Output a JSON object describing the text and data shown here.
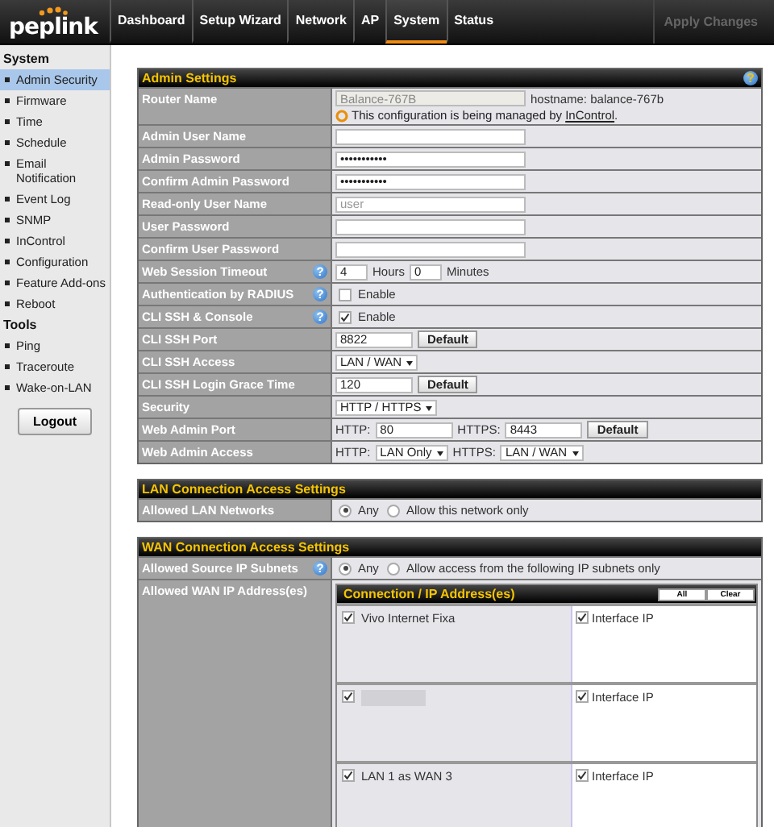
{
  "header": {
    "logo": "peplink",
    "tabs": [
      {
        "label": "Dashboard",
        "selected": false
      },
      {
        "label": "Setup Wizard",
        "selected": false
      },
      {
        "label": "Network",
        "selected": false
      },
      {
        "label": "AP",
        "selected": false
      },
      {
        "label": "System",
        "selected": true
      },
      {
        "label": "Status",
        "selected": false
      }
    ],
    "apply_button": {
      "label": "Apply Changes",
      "disabled": true
    }
  },
  "sidebar": {
    "sections": [
      {
        "title": "System",
        "items": [
          {
            "label": "Admin Security",
            "selected": true
          },
          {
            "label": "Firmware",
            "selected": false
          },
          {
            "label": "Time",
            "selected": false
          },
          {
            "label": "Schedule",
            "selected": false
          },
          {
            "label": "Email Notification",
            "selected": false
          },
          {
            "label": "Event Log",
            "selected": false
          },
          {
            "label": "SNMP",
            "selected": false
          },
          {
            "label": "InControl",
            "selected": false
          },
          {
            "label": "Configuration",
            "selected": false
          },
          {
            "label": "Feature Add-ons",
            "selected": false
          },
          {
            "label": "Reboot",
            "selected": false
          }
        ]
      },
      {
        "title": "Tools",
        "items": [
          {
            "label": "Ping",
            "selected": false
          },
          {
            "label": "Traceroute",
            "selected": false
          },
          {
            "label": "Wake-on-LAN",
            "selected": false
          }
        ]
      }
    ],
    "logout_button": "Logout"
  },
  "sections": [
    {
      "title": "Admin Settings",
      "help": "?",
      "rows": [
        {
          "label": "Router Name",
          "controls": [
            {
              "kind": "field",
              "value": "Balance-767B",
              "disabled": true
            },
            {
              "kind": "text",
              "text": "hostname: balance-767b"
            },
            {
              "kind": "notice",
              "text": "This configuration is being managed by ",
              "link": "InControl",
              "after": "."
            }
          ]
        },
        {
          "label": "Admin User Name",
          "controls": [
            {
              "kind": "field"
            }
          ]
        },
        {
          "label": "Admin Password",
          "controls": [
            {
              "kind": "field",
              "value": "•••••••••••"
            }
          ]
        },
        {
          "label": "Confirm Admin Password",
          "controls": [
            {
              "kind": "field",
              "value": "•••••••••••"
            }
          ]
        },
        {
          "label": "Read-only User Name",
          "controls": [
            {
              "kind": "field",
              "placeholder": "user"
            }
          ]
        },
        {
          "label": "User Password",
          "controls": [
            {
              "kind": "field"
            }
          ]
        },
        {
          "label": "Confirm User Password",
          "controls": [
            {
              "kind": "field"
            }
          ]
        },
        {
          "label": "Web Session Timeout",
          "help": "?",
          "controls": [
            {
              "kind": "number_field",
              "value": "4"
            },
            {
              "kind": "text",
              "text": "Hours"
            },
            {
              "kind": "number_field",
              "value": "0"
            },
            {
              "kind": "text",
              "text": "Minutes"
            }
          ]
        },
        {
          "label": "Authentication by RADIUS",
          "help": "?",
          "controls": [
            {
              "kind": "checkbox",
              "checked": false,
              "text": "Enable"
            }
          ]
        },
        {
          "label": "CLI SSH & Console",
          "help": "?",
          "controls": [
            {
              "kind": "checkbox",
              "checked": true,
              "text": "Enable"
            }
          ]
        },
        {
          "label": "CLI SSH Port",
          "controls": [
            {
              "kind": "port_field",
              "value": "8822"
            },
            {
              "kind": "button",
              "text": "Default"
            }
          ]
        },
        {
          "label": "CLI SSH Access",
          "controls": [
            {
              "kind": "select",
              "text": "LAN / WAN"
            }
          ]
        },
        {
          "label": "CLI SSH Login Grace Time",
          "controls": [
            {
              "kind": "port_field",
              "value": "120"
            },
            {
              "kind": "button",
              "text": "Default"
            }
          ]
        },
        {
          "label": "Security",
          "controls": [
            {
              "kind": "select",
              "text": "HTTP / HTTPS"
            }
          ]
        },
        {
          "label": "Web Admin Port",
          "controls": [
            {
              "kind": "text",
              "text": "HTTP:"
            },
            {
              "kind": "port_field",
              "value": "80"
            },
            {
              "kind": "text",
              "text": "HTTPS:"
            },
            {
              "kind": "port_field",
              "value": "8443"
            },
            {
              "kind": "button",
              "text": "Default"
            }
          ]
        },
        {
          "label": "Web Admin Access",
          "controls": [
            {
              "kind": "text",
              "text": "HTTP:"
            },
            {
              "kind": "select",
              "text": "LAN Only"
            },
            {
              "kind": "text",
              "text": "HTTPS:"
            },
            {
              "kind": "select",
              "text": "LAN / WAN"
            }
          ]
        }
      ]
    },
    {
      "title": "LAN Connection Access Settings",
      "rows": [
        {
          "label": "Allowed LAN Networks",
          "controls": [
            {
              "kind": "radio",
              "selected": true,
              "text": "Any"
            },
            {
              "kind": "radio",
              "selected": false,
              "text": "Allow this network only"
            }
          ]
        }
      ]
    },
    {
      "title": "WAN Connection Access Settings",
      "rows": [
        {
          "label": "Allowed Source IP Subnets",
          "help": "?",
          "controls": [
            {
              "kind": "radio",
              "selected": true,
              "text": "Any"
            },
            {
              "kind": "radio",
              "selected": false,
              "text": "Allow access from the following IP subnets only"
            }
          ]
        },
        {
          "label": "Allowed WAN IP Address(es)",
          "controls": [
            {
              "kind": "connection_table",
              "title": "Connection / IP Address(es)",
              "buttons": [
                "All",
                "Clear"
              ],
              "rows": [
                {
                  "connection": "Vivo Internet Fixa",
                  "redacted": false,
                  "checked": true,
                  "address": "Interface IP",
                  "address_checked": true
                },
                {
                  "redacted": true,
                  "checked": true,
                  "address": "Interface IP",
                  "address_checked": true
                },
                {
                  "connection": "LAN 1 as WAN 3",
                  "redacted": false,
                  "checked": true,
                  "address": "Interface IP",
                  "address_checked": true
                }
              ]
            }
          ]
        }
      ]
    }
  ]
}
